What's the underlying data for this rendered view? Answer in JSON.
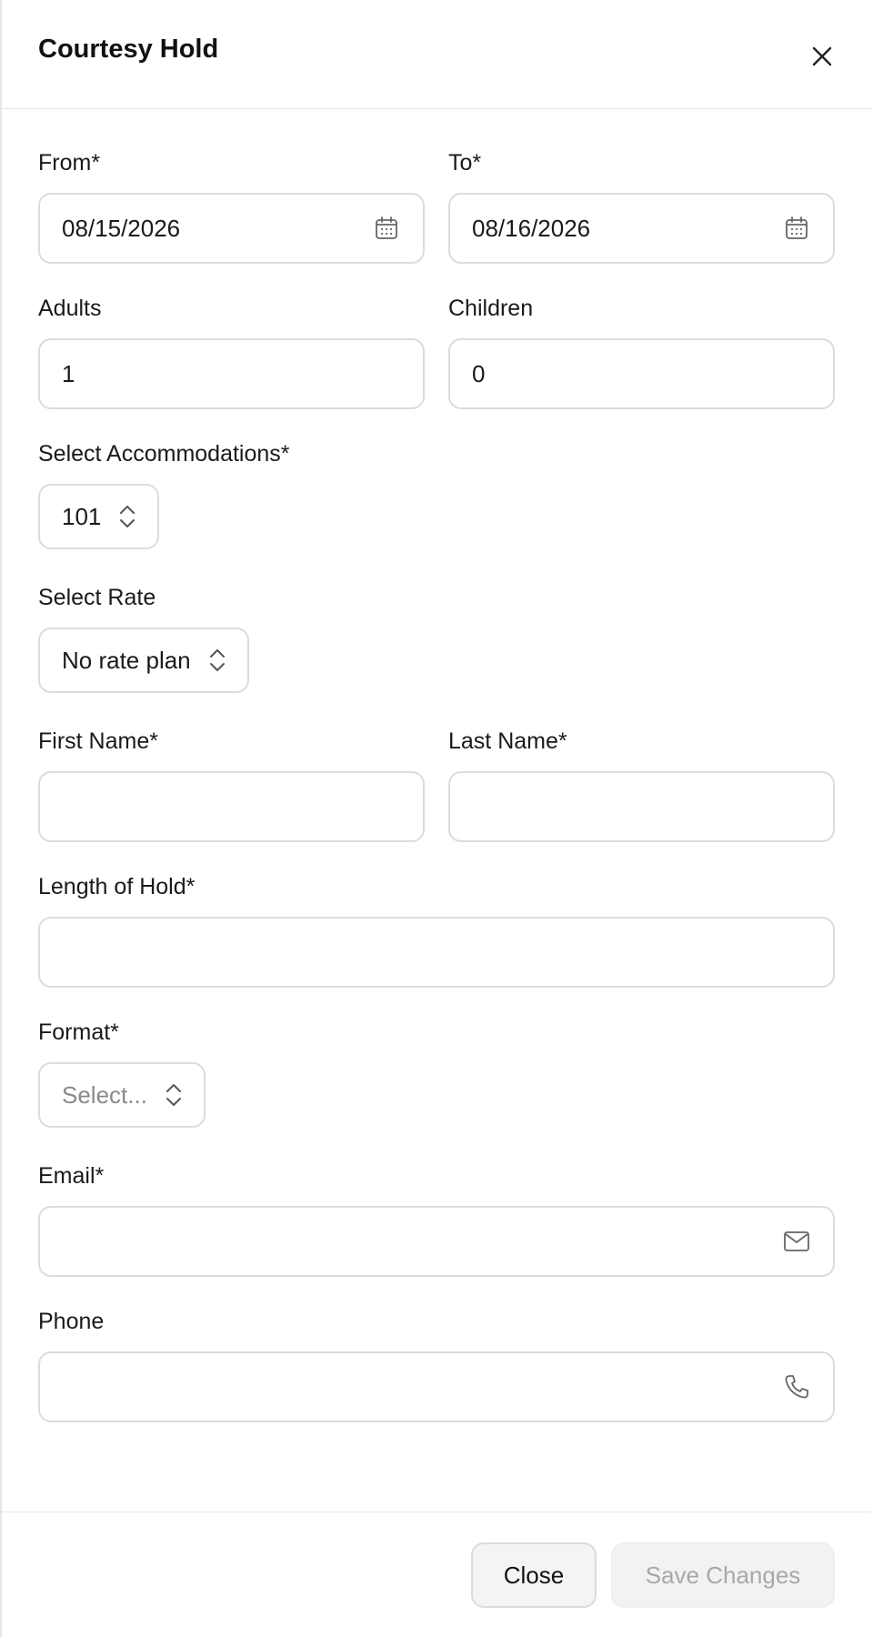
{
  "dialog": {
    "title": "Courtesy Hold"
  },
  "form": {
    "from": {
      "label": "From*",
      "value": "08/15/2026",
      "icon": "calendar-icon"
    },
    "to": {
      "label": "To*",
      "value": "08/16/2026",
      "icon": "calendar-icon"
    },
    "adults": {
      "label": "Adults",
      "value": "1"
    },
    "children": {
      "label": "Children",
      "value": "0"
    },
    "accommodations": {
      "label": "Select Accommodations*",
      "value": "101"
    },
    "rate": {
      "label": "Select Rate",
      "value": "No rate plan"
    },
    "first_name": {
      "label": "First Name*",
      "value": ""
    },
    "last_name": {
      "label": "Last Name*",
      "value": ""
    },
    "length_of_hold": {
      "label": "Length of Hold*",
      "value": ""
    },
    "format": {
      "label": "Format*",
      "placeholder": "Select..."
    },
    "email": {
      "label": "Email*",
      "value": "",
      "icon": "mail-icon"
    },
    "phone": {
      "label": "Phone",
      "value": "",
      "icon": "phone-icon"
    }
  },
  "footer": {
    "close_label": "Close",
    "save_label": "Save Changes"
  }
}
